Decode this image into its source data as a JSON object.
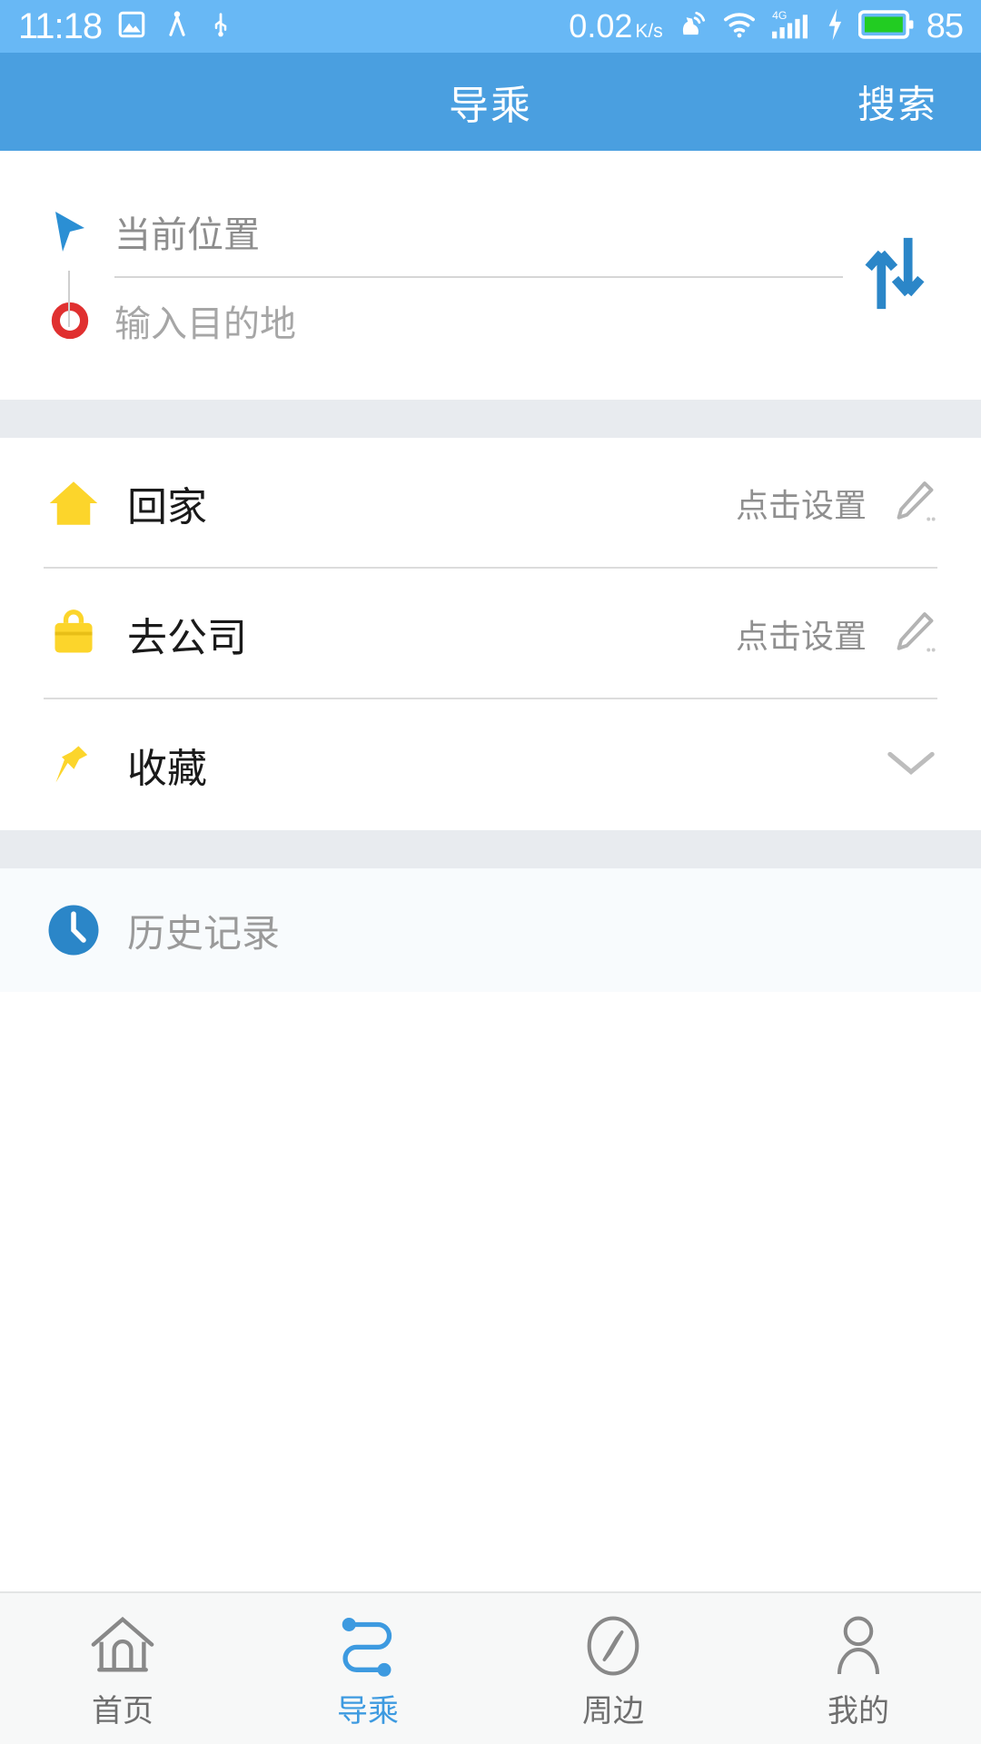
{
  "statusbar": {
    "time": "11:18",
    "icons_left": [
      "image-icon",
      "sharing-icon",
      "usb-icon"
    ],
    "net_speed": "0.02",
    "net_speed_unit": "K/s",
    "icons_right": [
      "touch-assist-icon",
      "wifi-icon",
      "signal-4g-icon",
      "charging-bolt-icon",
      "battery-icon"
    ],
    "signal_label": "4G",
    "battery_level": "85",
    "bg_color": "#68b8f5",
    "battery_fill_color": "#22cc22"
  },
  "header": {
    "title": "导乘",
    "action_label": "搜索",
    "bg_color": "#4a9fe0"
  },
  "route": {
    "origin": {
      "icon": "navigation-arrow-icon",
      "placeholder": "当前位置",
      "value": ""
    },
    "destination": {
      "icon": "destination-circle-icon",
      "placeholder": "输入目的地",
      "value": ""
    },
    "swap_icon": "swap-vertical-icon",
    "origin_icon_color": "#2b8fd4",
    "destination_icon_color": "#e03030",
    "swap_icon_color": "#2b86c8"
  },
  "shortcuts": [
    {
      "icon": "home-house-icon",
      "icon_color": "#fcd52b",
      "label": "回家",
      "hint": "点击设置",
      "action_icon": "pencil-edit-icon"
    },
    {
      "icon": "briefcase-icon",
      "icon_color": "#fcd52b",
      "label": "去公司",
      "hint": "点击设置",
      "action_icon": "pencil-edit-icon"
    },
    {
      "icon": "pin-star-icon",
      "icon_color": "#fcd52b",
      "label": "收藏",
      "hint": "",
      "action_icon": "chevron-down-icon"
    }
  ],
  "history": {
    "icon": "clock-icon",
    "icon_color": "#2b86c8",
    "label": "历史记录"
  },
  "tabbar": {
    "active_color": "#3d9ae0",
    "inactive_color": "#6e6e6e",
    "items": [
      {
        "icon": "home-outline-icon",
        "label": "首页",
        "active": false
      },
      {
        "icon": "route-path-icon",
        "label": "导乘",
        "active": true
      },
      {
        "icon": "compass-icon",
        "label": "周边",
        "active": false
      },
      {
        "icon": "person-icon",
        "label": "我的",
        "active": false
      }
    ]
  }
}
